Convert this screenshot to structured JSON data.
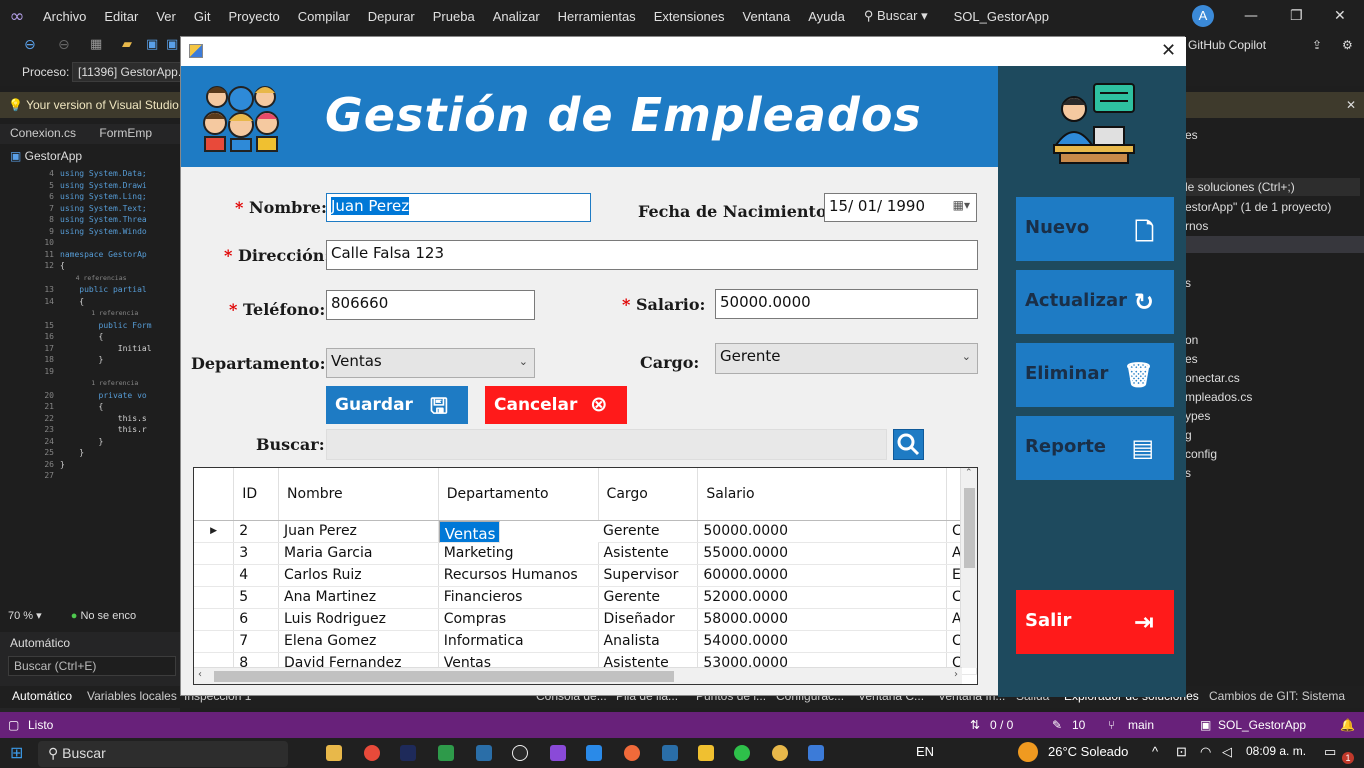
{
  "vs": {
    "menu": [
      "Archivo",
      "Editar",
      "Ver",
      "Git",
      "Proyecto",
      "Compilar",
      "Depurar",
      "Prueba",
      "Analizar",
      "Herramientas",
      "Extensiones",
      "Ventana",
      "Ayuda"
    ],
    "search_label": "Buscar",
    "solution_name": "SOL_GestorApp",
    "avatar_letter": "A",
    "copilot_label": "GitHub Copilot",
    "process_label": "Proceso:",
    "process_value": "[11396] GestorApp.",
    "info_message": "Your version of Visual Studio",
    "doc_tabs": [
      "Conexion.cs",
      "FormEmp"
    ],
    "doc_path": "GestorApp",
    "zoom": "70 %",
    "issues_label": "No se enco",
    "auto_panel_title": "Automático",
    "auto_search_placeholder": "Buscar (Ctrl+E)",
    "bottom_tabs": [
      "Automático",
      "Variables locales",
      "Inspección 1",
      "Consola de...",
      "Pila de lla...",
      "Puntos de i...",
      "Configurac...",
      "Ventana C...",
      "Ventana In...",
      "Salida",
      "Explorador de soluciones",
      "Cambios de GIT: Sistema"
    ],
    "right_panel": {
      "title": "es",
      "search": "le soluciones (Ctrl+;)",
      "solution": "estorApp\"  (1 de 1 proyecto)",
      "items": [
        "rnos",
        "s",
        "on",
        "es",
        "onectar.cs",
        "mpleados.cs",
        "ypes",
        "g",
        "config",
        "s"
      ]
    },
    "status": {
      "ready": "Listo",
      "git_changes": "0 / 0",
      "pencil_count": "10",
      "branch": "main",
      "solution": "SOL_GestorApp"
    },
    "code_lines": [
      {
        "n": "4",
        "t": "using System.Data;"
      },
      {
        "n": "5",
        "t": "using System.Drawi"
      },
      {
        "n": "6",
        "t": "using System.Linq;"
      },
      {
        "n": "7",
        "t": "using System.Text;"
      },
      {
        "n": "8",
        "t": "using System.Threa"
      },
      {
        "n": "9",
        "t": "using System.Windo"
      },
      {
        "n": "10",
        "t": ""
      },
      {
        "n": "11",
        "t": "namespace GestorAp"
      },
      {
        "n": "12",
        "t": "{"
      },
      {
        "n": "",
        "t": "    4 referencias"
      },
      {
        "n": "13",
        "t": "    public partial"
      },
      {
        "n": "14",
        "t": "    {"
      },
      {
        "n": "",
        "t": "        1 referencia"
      },
      {
        "n": "15",
        "t": "        public Form"
      },
      {
        "n": "16",
        "t": "        {"
      },
      {
        "n": "17",
        "t": "            Initial"
      },
      {
        "n": "18",
        "t": "        }"
      },
      {
        "n": "19",
        "t": ""
      },
      {
        "n": "",
        "t": "        1 referencia"
      },
      {
        "n": "20",
        "t": "        private vo"
      },
      {
        "n": "21",
        "t": "        {"
      },
      {
        "n": "22",
        "t": "            this.s"
      },
      {
        "n": "23",
        "t": "            this.r"
      },
      {
        "n": "24",
        "t": "        }"
      },
      {
        "n": "25",
        "t": "    }"
      },
      {
        "n": "26",
        "t": "}"
      },
      {
        "n": "27",
        "t": ""
      }
    ]
  },
  "taskbar": {
    "search": "Buscar",
    "language": "EN",
    "weather": "26°C  Soleado",
    "time": "08:09 a. m.",
    "notif_count": "1"
  },
  "form": {
    "title": "Gestión de Empleados",
    "labels": {
      "nombre": "Nombre:",
      "fecha": "Fecha de Nacimiento:",
      "direccion": "Dirección:",
      "telefono": "Teléfono:",
      "salario": "Salario:",
      "departamento": "Departamento:",
      "cargo": "Cargo:",
      "buscar": "Buscar:"
    },
    "required_mark": "*",
    "values": {
      "nombre": "Juan Perez",
      "fecha": "15/ 01/ 1990",
      "direccion": "Calle Falsa 123",
      "telefono": "806660",
      "salario": "50000.0000",
      "departamento": "Ventas",
      "cargo": "Gerente",
      "buscar": ""
    },
    "buttons": {
      "guardar": "Guardar",
      "cancelar": "Cancelar",
      "nuevo": "Nuevo",
      "actualizar": "Actualizar",
      "eliminar": "Eliminar",
      "reporte": "Reporte",
      "salir": "Salir"
    },
    "colors": {
      "header_blue": "#1e7bc4",
      "side_panel": "#1e4a5e",
      "danger_red": "#ff1a1a"
    },
    "grid": {
      "columns": [
        "ID",
        "Nombre",
        "Departamento",
        "Cargo",
        "Salario"
      ],
      "rows": [
        {
          "id": "2",
          "nombre": "Juan Perez",
          "departamento": "Ventas",
          "cargo": "Gerente",
          "salario": "50000.0000",
          "extra": "C"
        },
        {
          "id": "3",
          "nombre": "Maria Garcia",
          "departamento": "Marketing",
          "cargo": "Asistente",
          "salario": "55000.0000",
          "extra": "A"
        },
        {
          "id": "4",
          "nombre": "Carlos Ruiz",
          "departamento": "Recursos Humanos",
          "cargo": "Supervisor",
          "salario": "60000.0000",
          "extra": "E"
        },
        {
          "id": "5",
          "nombre": "Ana Martinez",
          "departamento": "Financieros",
          "cargo": "Gerente",
          "salario": "52000.0000",
          "extra": "C"
        },
        {
          "id": "6",
          "nombre": "Luis Rodriguez",
          "departamento": "Compras",
          "cargo": "Diseñador",
          "salario": "58000.0000",
          "extra": "A"
        },
        {
          "id": "7",
          "nombre": "Elena Gomez",
          "departamento": "Informatica",
          "cargo": "Analista",
          "salario": "54000.0000",
          "extra": "C"
        },
        {
          "id": "8",
          "nombre": "David Fernandez",
          "departamento": "Ventas",
          "cargo": "Asistente",
          "salario": "53000.0000",
          "extra": "C"
        }
      ]
    }
  }
}
